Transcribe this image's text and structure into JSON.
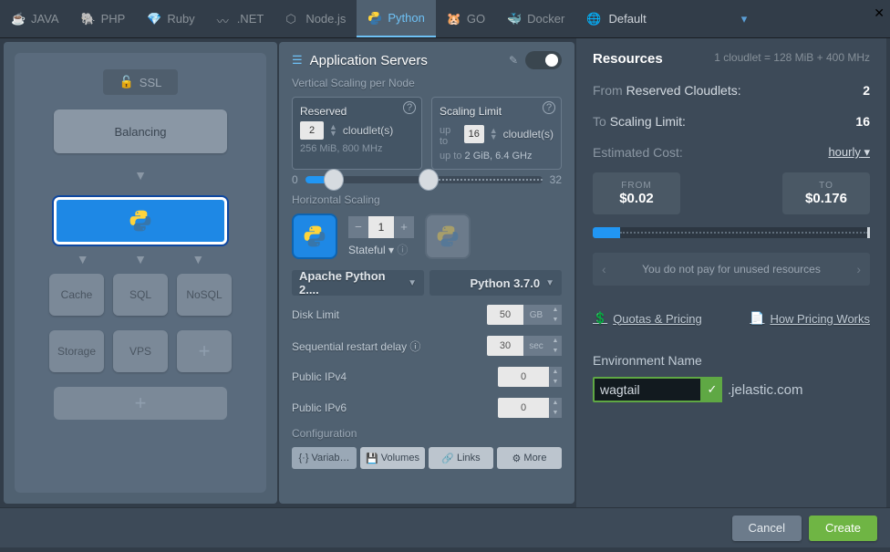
{
  "tabs": [
    {
      "label": "JAVA",
      "icon": "java-icon"
    },
    {
      "label": "PHP",
      "icon": "php-icon"
    },
    {
      "label": "Ruby",
      "icon": "ruby-icon"
    },
    {
      "label": ".NET",
      "icon": "dotnet-icon"
    },
    {
      "label": "Node.js",
      "icon": "nodejs-icon"
    },
    {
      "label": "Python",
      "icon": "python-icon",
      "active": true
    },
    {
      "label": "GO",
      "icon": "go-icon"
    },
    {
      "label": "Docker",
      "icon": "docker-icon"
    }
  ],
  "region": {
    "label": "Default",
    "icon": "globe-icon"
  },
  "topology": {
    "ssl": "SSL",
    "balancing": "Balancing",
    "tiers1": [
      "Cache",
      "SQL",
      "NoSQL"
    ],
    "tiers2": [
      "Storage",
      "VPS"
    ]
  },
  "center": {
    "title": "Application Servers",
    "toggle": "ON",
    "vertical_label": "Vertical Scaling per Node",
    "reserved": {
      "title": "Reserved",
      "value": "2",
      "unit": "cloudlet(s)",
      "hint": "256 MiB, 800 MHz"
    },
    "limit": {
      "title": "Scaling Limit",
      "prefix": "up to",
      "value": "16",
      "unit": "cloudlet(s)",
      "hint_prefix": "up to",
      "hint": "2 GiB, 6.4 GHz"
    },
    "slider": {
      "min": "0",
      "max": "32"
    },
    "horizontal_label": "Horizontal Scaling",
    "count": "1",
    "stateful": "Stateful",
    "stack": "Apache Python 2....",
    "version": "Python 3.7.0",
    "disk": {
      "label": "Disk Limit",
      "value": "50",
      "unit": "GB"
    },
    "restart": {
      "label": "Sequential restart delay",
      "value": "30",
      "unit": "sec"
    },
    "ipv4": {
      "label": "Public IPv4",
      "value": "0"
    },
    "ipv6": {
      "label": "Public IPv6",
      "value": "0"
    },
    "config_label": "Configuration",
    "config_buttons": [
      "Variab…",
      "Volumes",
      "Links",
      "More"
    ]
  },
  "right": {
    "title": "Resources",
    "subtitle": "1 cloudlet = 128 MiB + 400 MHz",
    "from_label": "From",
    "from_label2": "Reserved Cloudlets:",
    "from_val": "2",
    "to_label": "To",
    "to_label2": "Scaling Limit:",
    "to_val": "16",
    "cost_label": "Estimated Cost:",
    "cost_period": "hourly",
    "price_from": {
      "label": "FROM",
      "value": "$0.02"
    },
    "price_to": {
      "label": "TO",
      "value": "$0.176"
    },
    "banner": "You do not pay for unused resources",
    "link_quotas": "Quotas & Pricing",
    "link_how": "How Pricing Works",
    "env_label": "Environment Name",
    "env_value": "wagtail",
    "env_suffix": ".jelastic.com"
  },
  "footer": {
    "cancel": "Cancel",
    "create": "Create"
  }
}
